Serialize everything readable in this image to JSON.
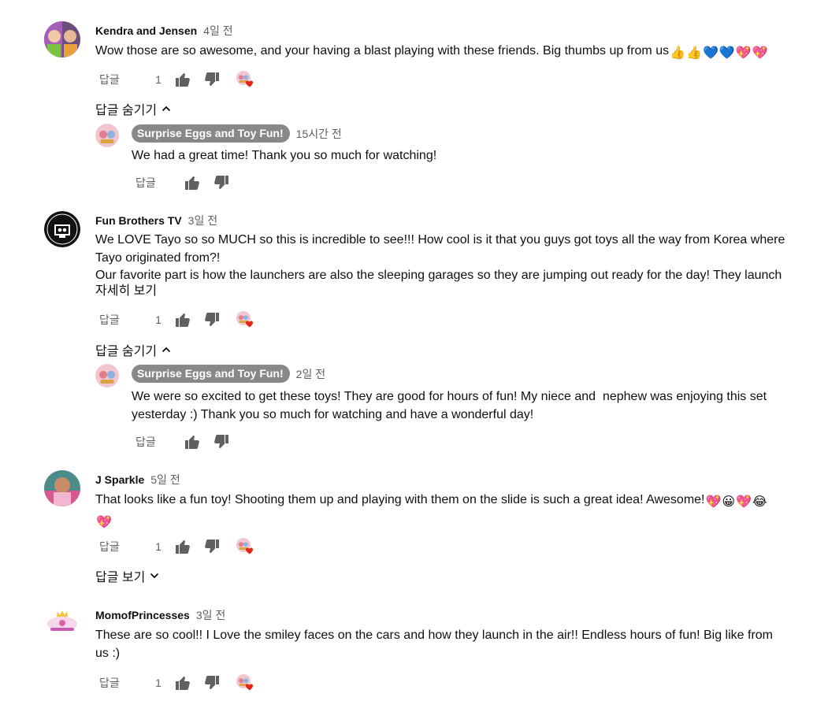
{
  "comments": [
    {
      "author": "Kendra and Jensen",
      "time": "4일 전",
      "text": "Wow those are so awesome, and your having a blast playing with these friends. Big thumbs up from us",
      "likes": "1",
      "reply_label": "답글",
      "toggle_label": "답글 숨기기",
      "reply": {
        "author": "Surprise Eggs and Toy Fun!",
        "time": "15시간 전",
        "text": "We had a great time! Thank you so much for watching!",
        "reply_label": "답글"
      }
    },
    {
      "author": "Fun Brothers TV",
      "time": "3일 전",
      "text": "We LOVE Tayo so so MUCH so this is incredible to see!!! How cool is it that you guys got toys all the way from Korea where Tayo originated from?!\nOur favorite part is how the launchers are also the sleeping garages so they are jumping out ready for the day! They launch",
      "read_more": "자세히 보기",
      "likes": "1",
      "reply_label": "답글",
      "toggle_label": "답글 숨기기",
      "reply": {
        "author": "Surprise Eggs and Toy Fun!",
        "time": "2일 전",
        "text": "We were so excited to get these toys! They are good for hours of fun! My niece and  nephew was enjoying this set yesterday :) Thank you so much for watching and have a wonderful day!",
        "reply_label": "답글"
      }
    },
    {
      "author": "J Sparkle",
      "time": "5일 전",
      "text": "That looks like a fun toy! Shooting them up and playing with them on the slide is such a great idea! Awesome!",
      "likes": "1",
      "reply_label": "답글",
      "toggle_label": "답글 보기"
    },
    {
      "author": "MomofPrincesses",
      "time": "3일 전",
      "text": "These are so cool!! I Love the smiley faces on the cars and how they launch in the air!! Endless hours of fun! Big like from us :)",
      "likes": "1",
      "reply_label": "답글"
    }
  ],
  "icons": [
    "thumbs-up-icon",
    "thumbs-down-icon",
    "creator-heart-icon",
    "chevron-up-icon",
    "chevron-down-icon"
  ],
  "colors": {
    "heart": "#e62117",
    "secondary_text": "#606060",
    "author_chip": "#888888"
  }
}
